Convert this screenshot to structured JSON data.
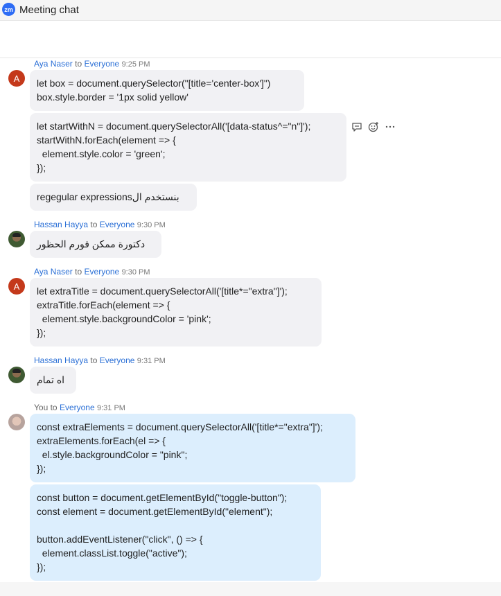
{
  "window": {
    "app_icon_text": "zm",
    "title": "Meeting chat"
  },
  "labels": {
    "to": "to"
  },
  "messages": {
    "m1": {
      "sender": "Aya Naser",
      "recipient": "Everyone",
      "time": "9:25 PM",
      "avatar_letter": "A",
      "b1": [
        "let box = document.querySelector(\"[title='center-box']\")",
        "box.style.border = '1px solid yellow'"
      ],
      "b2": [
        "let startWithN = document.querySelectorAll('[data-status^=\"n\"]');",
        "startWithN.forEach(element => {",
        "  element.style.color = 'green';",
        "});"
      ],
      "b3": [
        "regegular expressionsبنستخدم ال"
      ]
    },
    "m2": {
      "sender": "Hassan Hayya",
      "recipient": "Everyone",
      "time": "9:30 PM",
      "b1": [
        "دكتورة ممكن فورم الحظور"
      ]
    },
    "m3": {
      "sender": "Aya Naser",
      "recipient": "Everyone",
      "time": "9:30 PM",
      "avatar_letter": "A",
      "b1": [
        "let extraTitle = document.querySelectorAll('[title*=\"extra\"]');",
        "extraTitle.forEach(element => {",
        "  element.style.backgroundColor = 'pink';",
        "});"
      ]
    },
    "m4": {
      "sender": "Hassan Hayya",
      "recipient": "Everyone",
      "time": "9:31 PM",
      "b1": [
        "اه تمام"
      ]
    },
    "m5": {
      "sender": "You",
      "recipient": "Everyone",
      "time": "9:31 PM",
      "b1": [
        "const extraElements = document.querySelectorAll('[title*=\"extra\"]');",
        "extraElements.forEach(el => {",
        "  el.style.backgroundColor = \"pink\";",
        "});"
      ],
      "b2": [
        "const button = document.getElementById(\"toggle-button\");",
        "const element = document.getElementById(\"element\");",
        "",
        "button.addEventListener(\"click\", () => {",
        "  element.classList.toggle(\"active\");",
        "});"
      ]
    }
  },
  "hover_actions": [
    "reply-in-thread-icon",
    "add-reaction-icon",
    "more-options-icon"
  ],
  "colors": {
    "name_link": "#2a6fd6",
    "bubble_other": "#f1f1f4",
    "bubble_mine": "#dceefd",
    "avatar_letter_bg": "#c4391b",
    "app_icon": "#2d6cf5"
  }
}
